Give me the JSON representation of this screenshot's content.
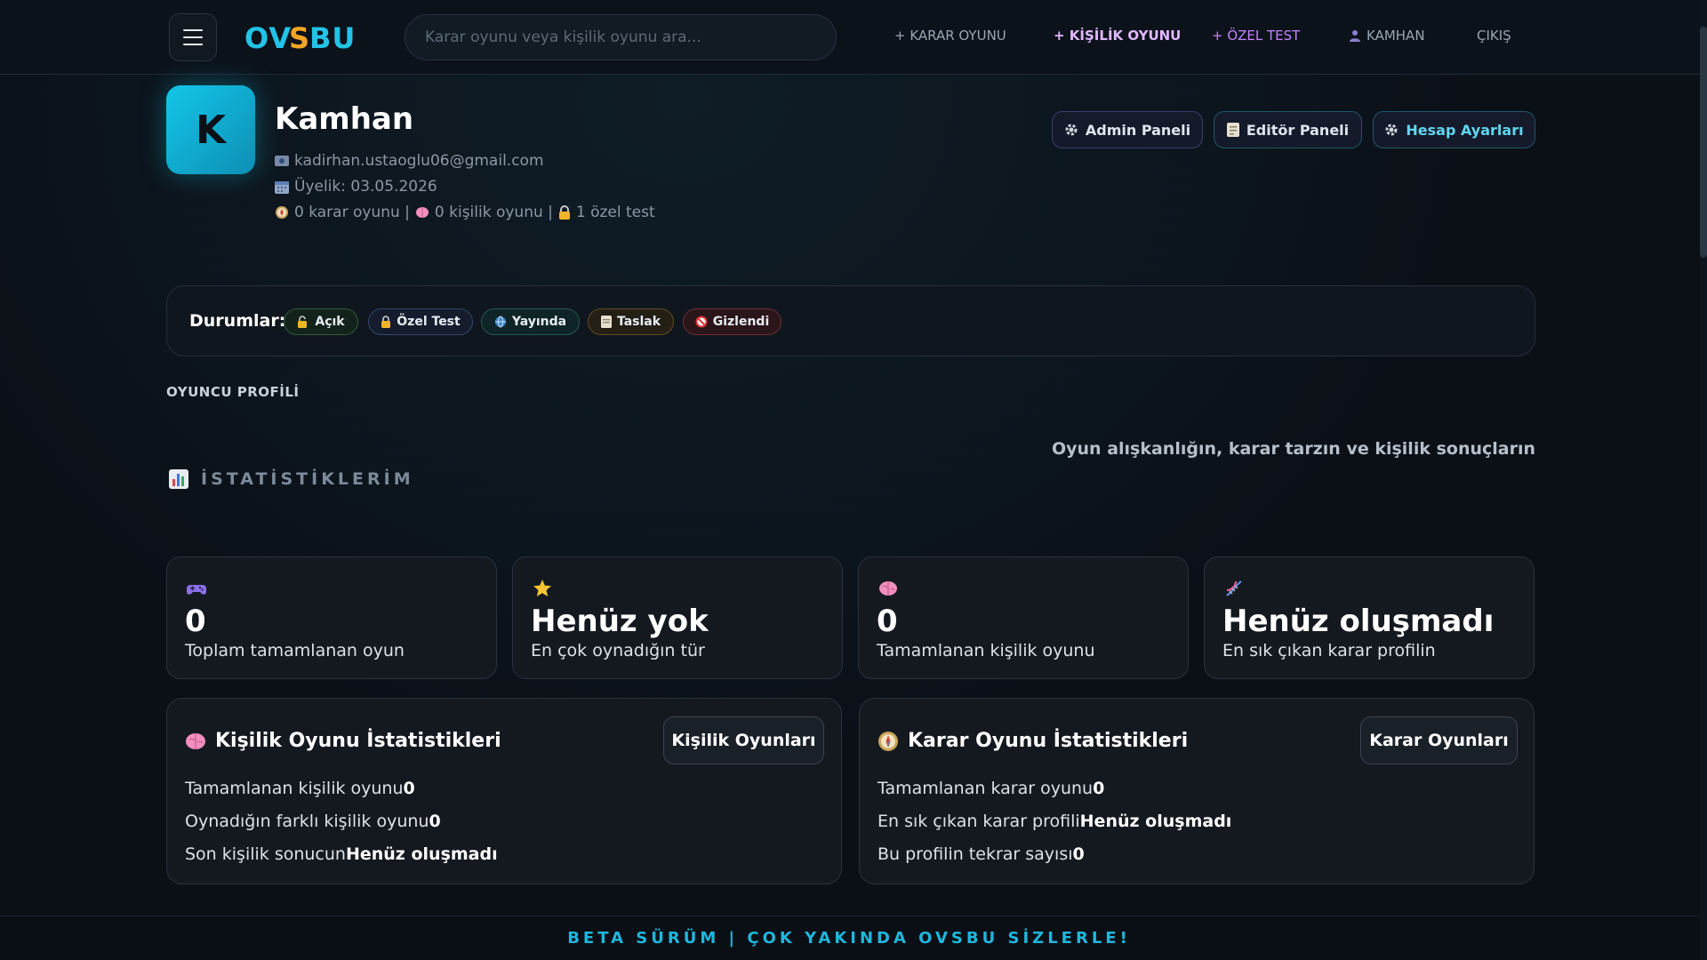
{
  "header": {
    "logo": "OVSBU",
    "search_placeholder": "Karar oyunu veya kişilik oyunu ara...",
    "nav": [
      {
        "label": "+ KARAR OYUNU"
      },
      {
        "label": "+ KİŞİLİK OYUNU"
      },
      {
        "label": "+ ÖZEL TEST"
      },
      {
        "label": "KAMHAN"
      },
      {
        "label": "ÇIKIŞ"
      }
    ]
  },
  "profile": {
    "avatar_letter": "K",
    "name": "Kamhan",
    "email": "kadirhan.ustaoglu06@gmail.com",
    "membership": "Üyelik: 03.05.2026",
    "counts": {
      "decision": "0 karar oyunu |",
      "personality": "0 kişilik oyunu |",
      "special": "1 özel test"
    },
    "buttons": {
      "admin": "Admin Paneli",
      "editor": "Editör Paneli",
      "account": "Hesap Ayarları"
    }
  },
  "status": {
    "title": "Durumlar:",
    "chips": [
      "Açık",
      "Özel Test",
      "Yayında",
      "Taslak",
      "Gizlendi"
    ]
  },
  "section": {
    "label": "OYUNCU PROFİLİ",
    "subtitle": "Oyun alışkanlığın, karar tarzın ve kişilik sonuçların",
    "stats_heading": "İSTATİSTİKLERİM"
  },
  "cards": [
    {
      "value": "0",
      "label": "Toplam tamamlanan oyun"
    },
    {
      "value": "Henüz yok",
      "label": "En çok oynadığın tür"
    },
    {
      "value": "0",
      "label": "Tamamlanan kişilik oyunu"
    },
    {
      "value": "Henüz oluşmadı",
      "label": "En sık çıkan karar profilin"
    }
  ],
  "personality_panel": {
    "title": "Kişilik Oyunu İstatistikleri",
    "button": "Kişilik Oyunları",
    "rows": [
      {
        "label": "Tamamlanan kişilik oyunu",
        "value": "0"
      },
      {
        "label": "Oynadığın farklı kişilik oyunu",
        "value": "0"
      },
      {
        "label": "Son kişilik sonucun",
        "value": "Henüz oluşmadı"
      }
    ]
  },
  "decision_panel": {
    "title": "Karar Oyunu İstatistikleri",
    "button": "Karar Oyunları",
    "rows": [
      {
        "label": "Tamamlanan karar oyunu",
        "value": "0"
      },
      {
        "label": "En sık çıkan karar profili",
        "value": "Henüz oluşmadı"
      },
      {
        "label": "Bu profilin tekrar sayısı",
        "value": "0"
      }
    ]
  },
  "footer": "BETA SÜRÜM | ÇOK YAKINDA OVSBU SİZLERLE!",
  "colors": {
    "accent_cyan": "#12c6e8",
    "accent_purple": "#c084fc",
    "background": "#0b1017"
  }
}
